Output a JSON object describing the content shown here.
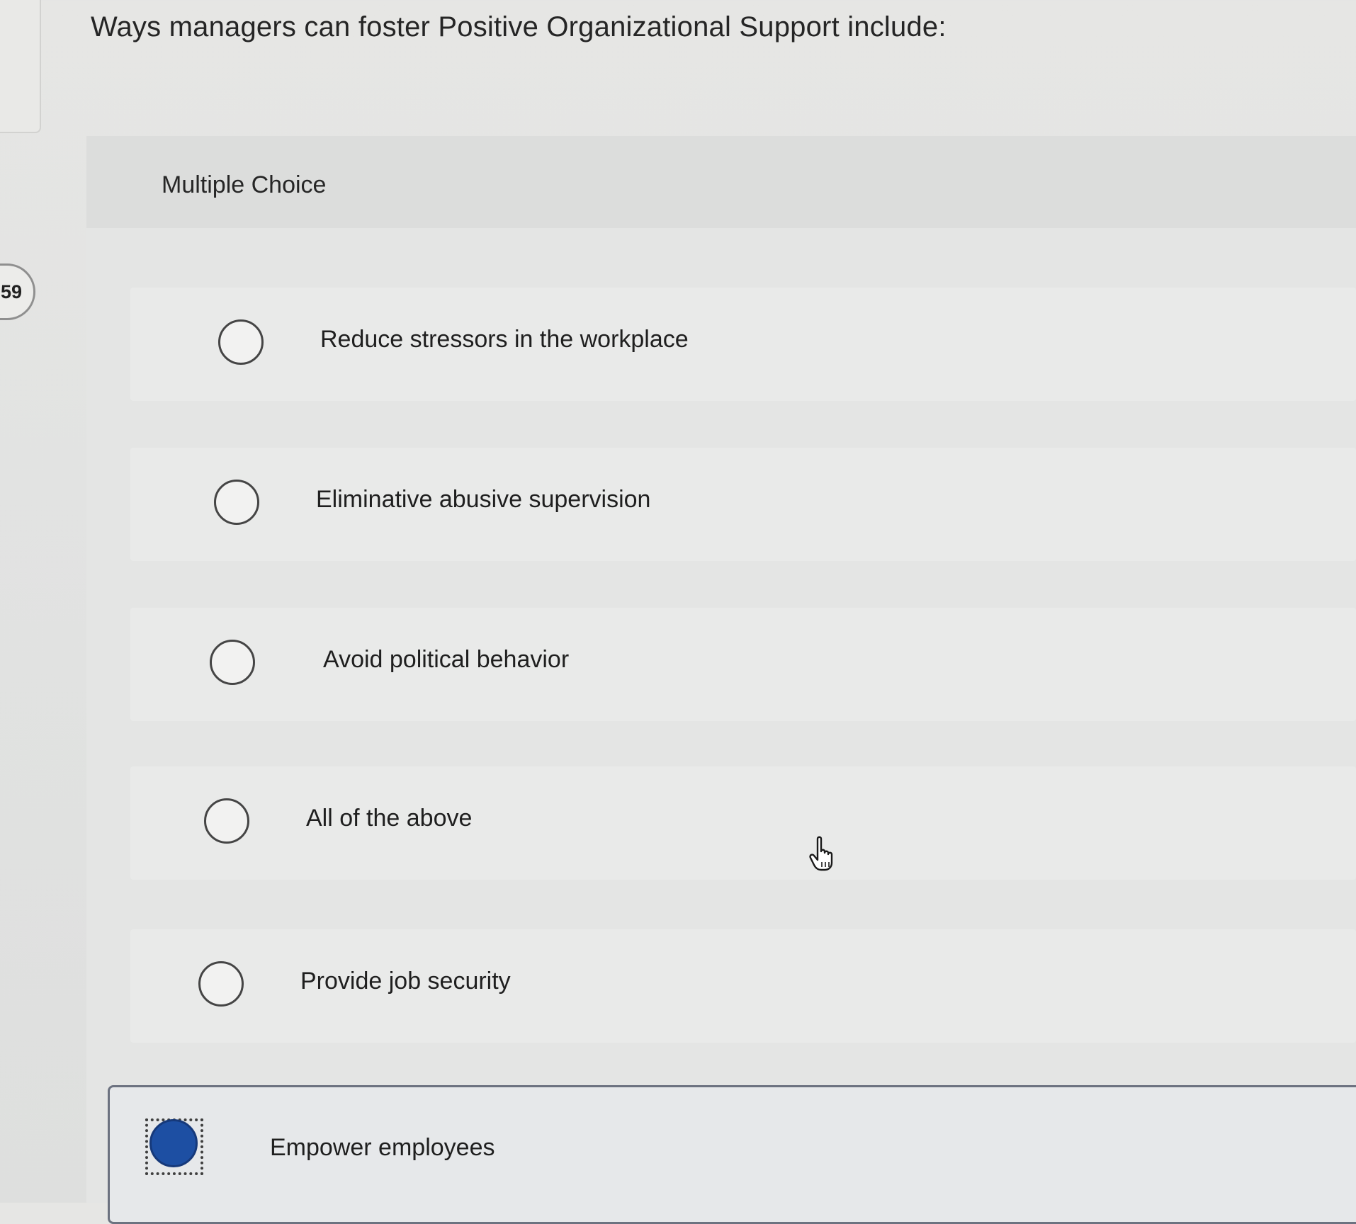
{
  "timer": {
    "text": ":59"
  },
  "question": {
    "title": "Ways managers can foster Positive Organizational Support include:",
    "type_label": "Multiple Choice"
  },
  "options": [
    {
      "label": "Reduce stressors in the workplace",
      "selected": false
    },
    {
      "label": "Eliminative abusive supervision",
      "selected": false
    },
    {
      "label": "Avoid political behavior",
      "selected": false
    },
    {
      "label": "All of the above",
      "selected": false
    },
    {
      "label": "Provide job security",
      "selected": false
    },
    {
      "label": "Empower employees",
      "selected": true
    }
  ],
  "colors": {
    "selected_radio": "#1d4fa3",
    "background": "#e3e4e3"
  },
  "icons": {
    "cursor": "hand-pointer-icon"
  }
}
